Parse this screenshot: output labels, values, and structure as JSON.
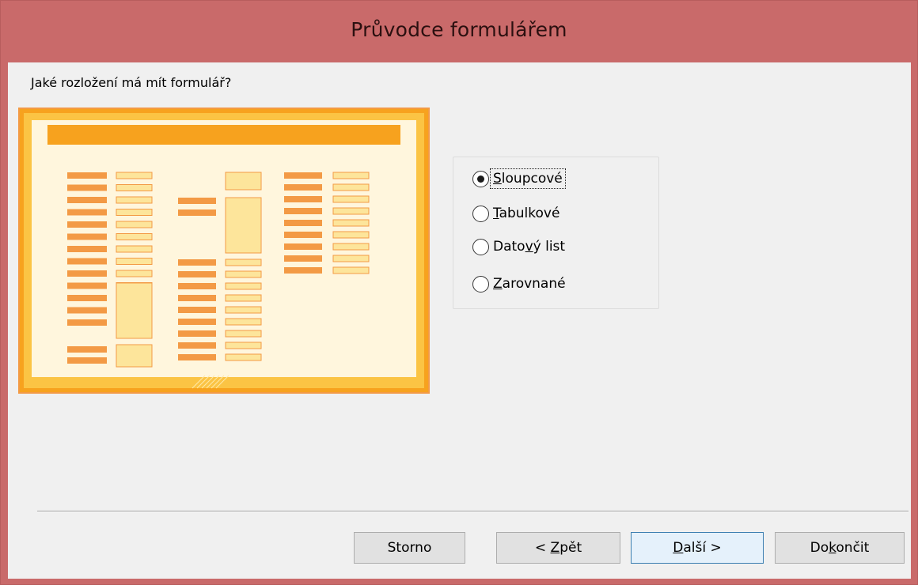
{
  "window": {
    "title": "Průvodce formulářem"
  },
  "question": "Jaké rozložení má mít formulář?",
  "layout_options": [
    {
      "pre": "",
      "accel": "S",
      "post": "loupcové",
      "selected": true
    },
    {
      "pre": "",
      "accel": "T",
      "post": "abulkové",
      "selected": false
    },
    {
      "pre": "Dato",
      "accel": "v",
      "post": "ý list",
      "selected": false
    },
    {
      "pre": "",
      "accel": "Z",
      "post": "arovnané",
      "selected": false
    }
  ],
  "buttons": {
    "cancel": {
      "pre": "Storno",
      "accel": "",
      "post": ""
    },
    "back": {
      "pre": "< ",
      "accel": "Z",
      "post": "pět"
    },
    "next": {
      "pre": "",
      "accel": "D",
      "post": "alší >"
    },
    "finish": {
      "pre": "Do",
      "accel": "k",
      "post": "ončit"
    }
  },
  "colors": {
    "titlebar": "#c96a6a",
    "client": "#f0f0f0",
    "preview_frame": "#f7a21e",
    "preview_label": "#f39a45",
    "preview_field": "#fde59b",
    "default_button_border": "#3c7fb1"
  }
}
